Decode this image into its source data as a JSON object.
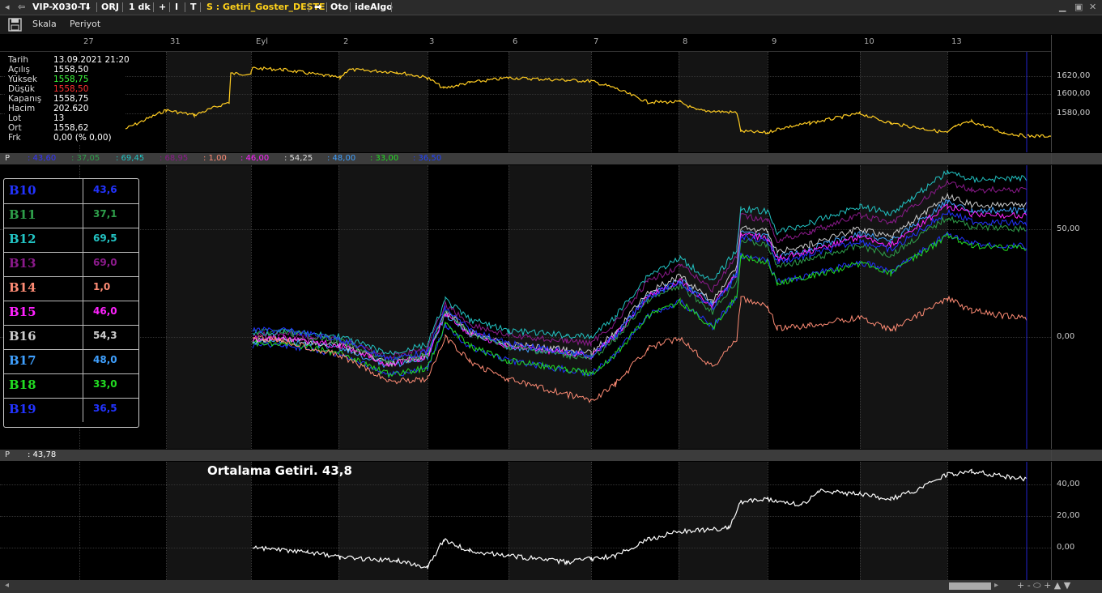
{
  "toolbar": {
    "symbol": "VIP-X030-T",
    "orj": "ORJ",
    "interval": "1 dk",
    "plus": "+",
    "i": "I",
    "t": "T",
    "system": "S : Getiri_Goster_DESTE",
    "oto": "Oto",
    "idealgo": "ideAlgo"
  },
  "menu": {
    "skala": "Skala",
    "periyot": "Periyot"
  },
  "xaxis": [
    "27",
    "31",
    "Eyl",
    "2",
    "3",
    "6",
    "7",
    "8",
    "9",
    "10",
    "13"
  ],
  "info": [
    {
      "key": "Tarih",
      "value": "13.09.2021 21:20",
      "color": "#ffffff"
    },
    {
      "key": "Açılış",
      "value": "1558,50",
      "color": "#ffffff"
    },
    {
      "key": "Yüksek",
      "value": "1558,75",
      "color": "#3cff3c"
    },
    {
      "key": "Düşük",
      "value": "1558,50",
      "color": "#ff3030"
    },
    {
      "key": "Kapanış",
      "value": "1558,75",
      "color": "#ffffff"
    },
    {
      "key": "Hacim",
      "value": "202.620",
      "color": "#ffffff"
    },
    {
      "key": "Lot",
      "value": "13",
      "color": "#ffffff"
    },
    {
      "key": "Ort",
      "value": "1558,62",
      "color": "#ffffff"
    },
    {
      "key": "Frk",
      "value": "0,00 (% 0,00)",
      "color": "#ffffff"
    }
  ],
  "price_axis": [
    "1620,00",
    "1600,00",
    "1580,00"
  ],
  "pbar1": {
    "label": "P",
    "values": [
      {
        "text": ": 43,60",
        "color": "#3333ff"
      },
      {
        "text": ": 37,05",
        "color": "#2e9e4a"
      },
      {
        "text": ": 69,45",
        "color": "#22c4c4"
      },
      {
        "text": ": 68,95",
        "color": "#8b1a8b"
      },
      {
        "text": ": 1,00",
        "color": "#ff8c75"
      },
      {
        "text": ": 46,00",
        "color": "#ff22ff"
      },
      {
        "text": ": 54,25",
        "color": "#dddddd"
      },
      {
        "text": ": 48,00",
        "color": "#3fa0ff"
      },
      {
        "text": ": 33,00",
        "color": "#22dd22"
      },
      {
        "text": ": 36,50",
        "color": "#2244ff"
      }
    ]
  },
  "legend": [
    {
      "name": "B10",
      "value": "43,6",
      "color": "#2233ff"
    },
    {
      "name": "B11",
      "value": "37,1",
      "color": "#2e9e4a"
    },
    {
      "name": "B12",
      "value": "69,5",
      "color": "#22c4c4"
    },
    {
      "name": "B13",
      "value": "69,0",
      "color": "#8b1a8b"
    },
    {
      "name": "B14",
      "value": "1,0",
      "color": "#ff8c75"
    },
    {
      "name": "B15",
      "value": "46,0",
      "color": "#ff22ff"
    },
    {
      "name": "B16",
      "value": "54,3",
      "color": "#cccccc"
    },
    {
      "name": "B17",
      "value": "48,0",
      "color": "#3fa0ff"
    },
    {
      "name": "B18",
      "value": "33,0",
      "color": "#22dd22"
    },
    {
      "name": "B19",
      "value": "36,5",
      "color": "#2233ff"
    }
  ],
  "mid_axis": [
    "50,00",
    "0,00"
  ],
  "pbar2": {
    "label": "P",
    "value": ": 43,78"
  },
  "bottom_title": "Ortalama Getiri. 43,8",
  "bottom_axis": [
    "40,00",
    "20,00",
    "0,00"
  ],
  "colors": {
    "price": "#ffcc22",
    "average": "#ffffff",
    "cursor": "#2222cc"
  }
}
